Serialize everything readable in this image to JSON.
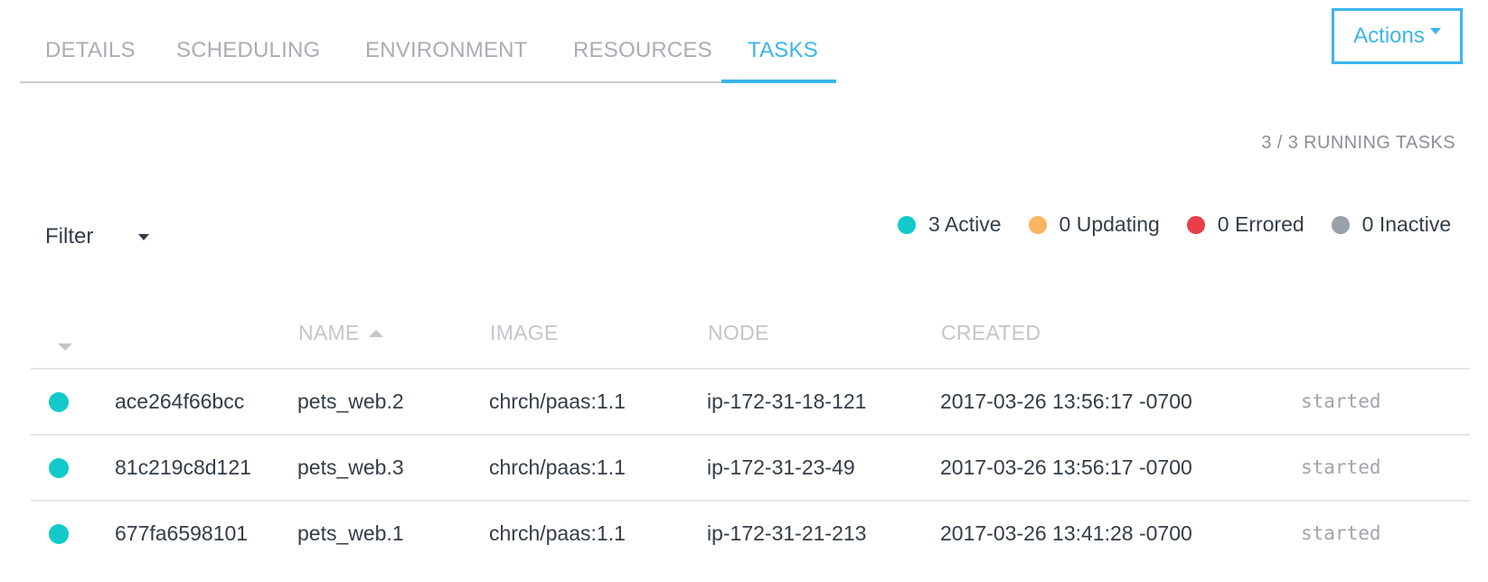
{
  "tabs": [
    {
      "label": "DETAILS",
      "active": false
    },
    {
      "label": "SCHEDULING",
      "active": false
    },
    {
      "label": "ENVIRONMENT",
      "active": false
    },
    {
      "label": "RESOURCES",
      "active": false
    },
    {
      "label": "TASKS",
      "active": true
    }
  ],
  "actions_label": "Actions",
  "running_tasks": "3 / 3 RUNNING TASKS",
  "filter_label": "Filter",
  "legend": [
    {
      "label": "3 Active",
      "color": "#12c9c9"
    },
    {
      "label": "0 Updating",
      "color": "#fbb45f"
    },
    {
      "label": "0 Errored",
      "color": "#ea3d4a"
    },
    {
      "label": "0 Inactive",
      "color": "#99a0a8"
    }
  ],
  "columns": {
    "name": "NAME",
    "image": "IMAGE",
    "node": "NODE",
    "created": "CREATED"
  },
  "colors": {
    "accent": "#3bb5ee",
    "active_dot": "#12c9c9"
  },
  "rows": [
    {
      "id": "ace264f66bcc",
      "name": "pets_web.2",
      "image": "chrch/paas:1.1",
      "node": "ip-172-31-18-121",
      "created": "2017-03-26 13:56:17 -0700",
      "status": "started"
    },
    {
      "id": "81c219c8d121",
      "name": "pets_web.3",
      "image": "chrch/paas:1.1",
      "node": "ip-172-31-23-49",
      "created": "2017-03-26 13:56:17 -0700",
      "status": "started"
    },
    {
      "id": "677fa6598101",
      "name": "pets_web.1",
      "image": "chrch/paas:1.1",
      "node": "ip-172-31-21-213",
      "created": "2017-03-26 13:41:28 -0700",
      "status": "started"
    }
  ]
}
